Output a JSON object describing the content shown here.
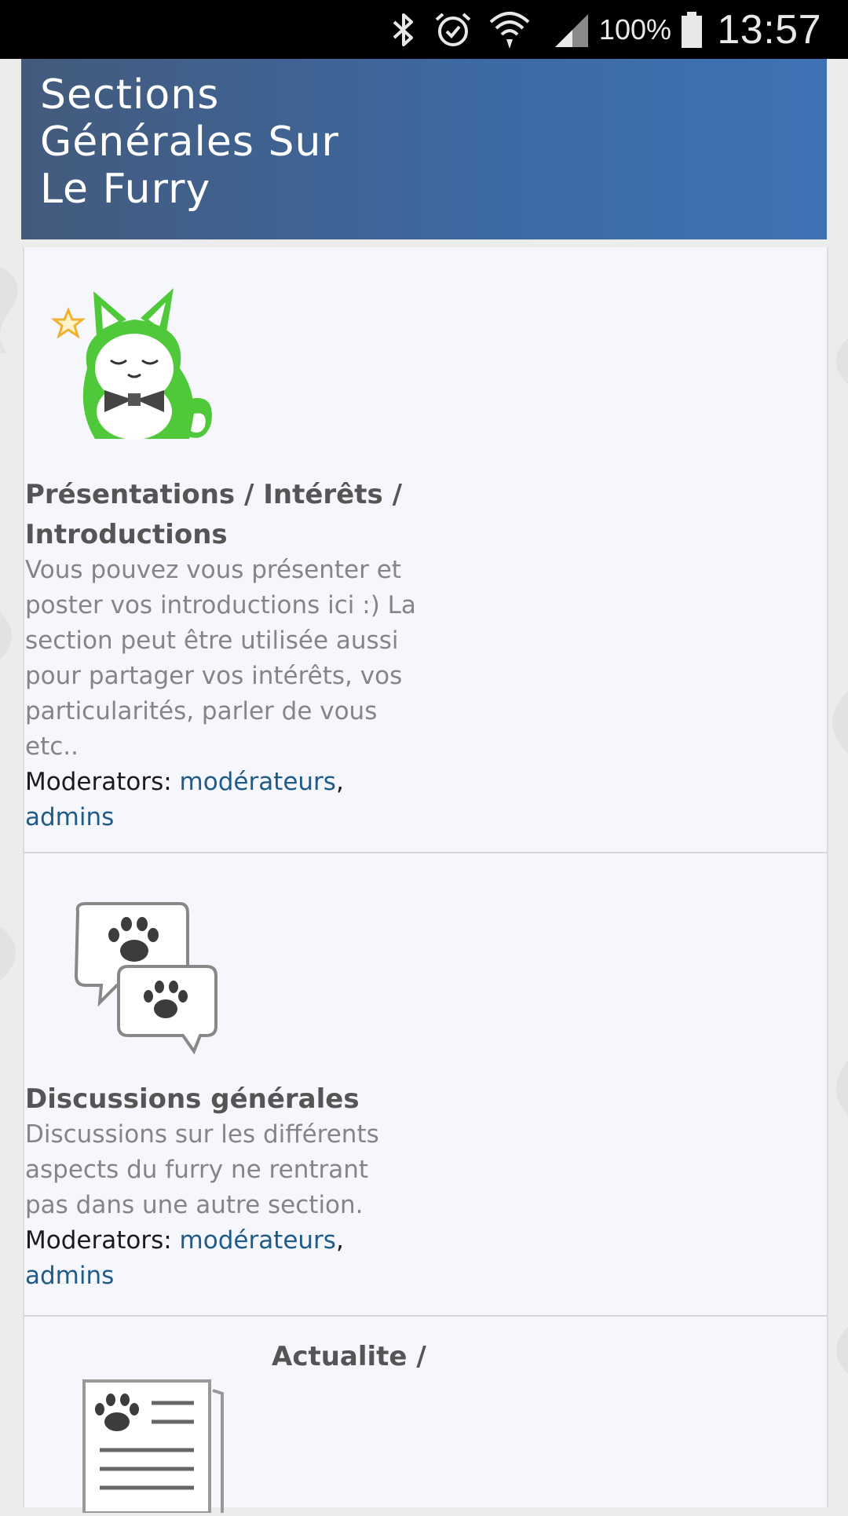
{
  "status_bar": {
    "time": "13:57",
    "battery_percent": "100%",
    "icons": [
      "bluetooth-icon",
      "alarm-icon",
      "wifi-icon",
      "signal-icon",
      "battery-icon"
    ]
  },
  "category": {
    "title": "Sections Générales Sur Le Furry"
  },
  "forums": [
    {
      "icon": "green-fox-mascot-icon",
      "title": "Présentations / Intérêts / Introductions",
      "description": "Vous pouvez vous présenter et poster vos introductions ici :) La section peut être utilisée aussi pour partager vos intérêts, vos particularités, parler de vous etc..",
      "moderators_label": "Moderators:",
      "moderators": [
        "modérateurs",
        "admins"
      ]
    },
    {
      "icon": "paw-speech-bubbles-icon",
      "title": "Discussions générales",
      "description": "Discussions sur les différents aspects du furry ne rentrant pas dans une autre section.",
      "moderators_label": "Moderators:",
      "moderators": [
        "modérateurs",
        "admins"
      ]
    },
    {
      "icon": "paw-newspaper-icon",
      "title": "Actualite /"
    }
  ],
  "colors": {
    "header_gradient_start": "#435a7c",
    "header_gradient_end": "#3f72b5",
    "link": "#1e5a8a",
    "row_background": "#f5f7fc"
  }
}
